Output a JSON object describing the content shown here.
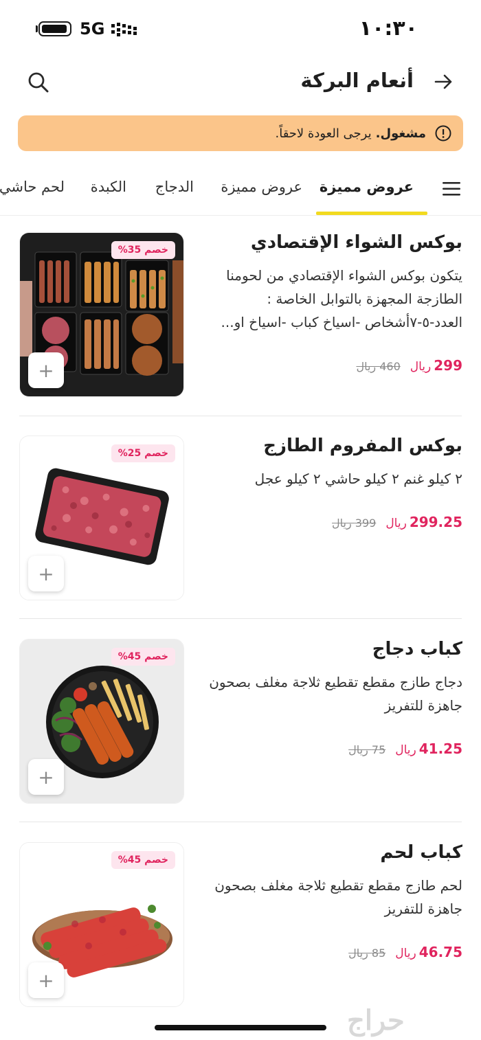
{
  "status_bar": {
    "time": "١٠:٣٠",
    "network": "5G",
    "battery_level": 0.85
  },
  "header": {
    "title": "أنعام البركة",
    "back_icon": "arrow-right-icon",
    "search_icon": "search-icon"
  },
  "banner": {
    "strong": "مشغول.",
    "text": "يرجى العودة لاحقاً.",
    "icon": "info-icon",
    "color": "#fbc58a"
  },
  "tabs": {
    "menu_icon": "menu-icon",
    "items": [
      "عروض مميزة",
      "عروض مميزة",
      "الدجاج",
      "الكبدة",
      "لحم حاشي"
    ],
    "active_index": 0,
    "underline_color": "#f2da1f"
  },
  "products": [
    {
      "name": "بوكس الشواء الإقتصادي",
      "description": "يتكون بوكس الشواء الإقتصادي من لحومنا الطازجة المجهزة بالتوابل الخاصة : العدد-٥-٧أشخاص -اسياخ كباب -اسياخ او...",
      "price": "299",
      "currency": "ريال",
      "old_price": "460 ريال",
      "discount": "خصم 35%",
      "add_label": "+"
    },
    {
      "name": "بوكس المفروم الطازج",
      "description": "٢ كيلو غنم ٢ كيلو حاشي ٢ كيلو عجل",
      "price": "299.25",
      "currency": "ريال",
      "old_price": "399 ريال",
      "discount": "خصم 25%",
      "add_label": "+"
    },
    {
      "name": "كباب دجاج",
      "description": "دجاج طازج مقطع تقطيع ثلاجة مغلف بصحون جاهزة للتفريز",
      "price": "41.25",
      "currency": "ريال",
      "old_price": "75 ريال",
      "discount": "خصم 45%",
      "add_label": "+"
    },
    {
      "name": "كباب لحم",
      "description": "لحم طازج مقطع تقطيع ثلاجة مغلف بصحون جاهزة للتفريز",
      "price": "46.75",
      "currency": "ريال",
      "old_price": "85 ريال",
      "discount": "خصم 45%",
      "add_label": "+"
    }
  ],
  "colors": {
    "price": "#e0245e",
    "badge_bg": "#fde5ee"
  },
  "watermark": "حراج"
}
